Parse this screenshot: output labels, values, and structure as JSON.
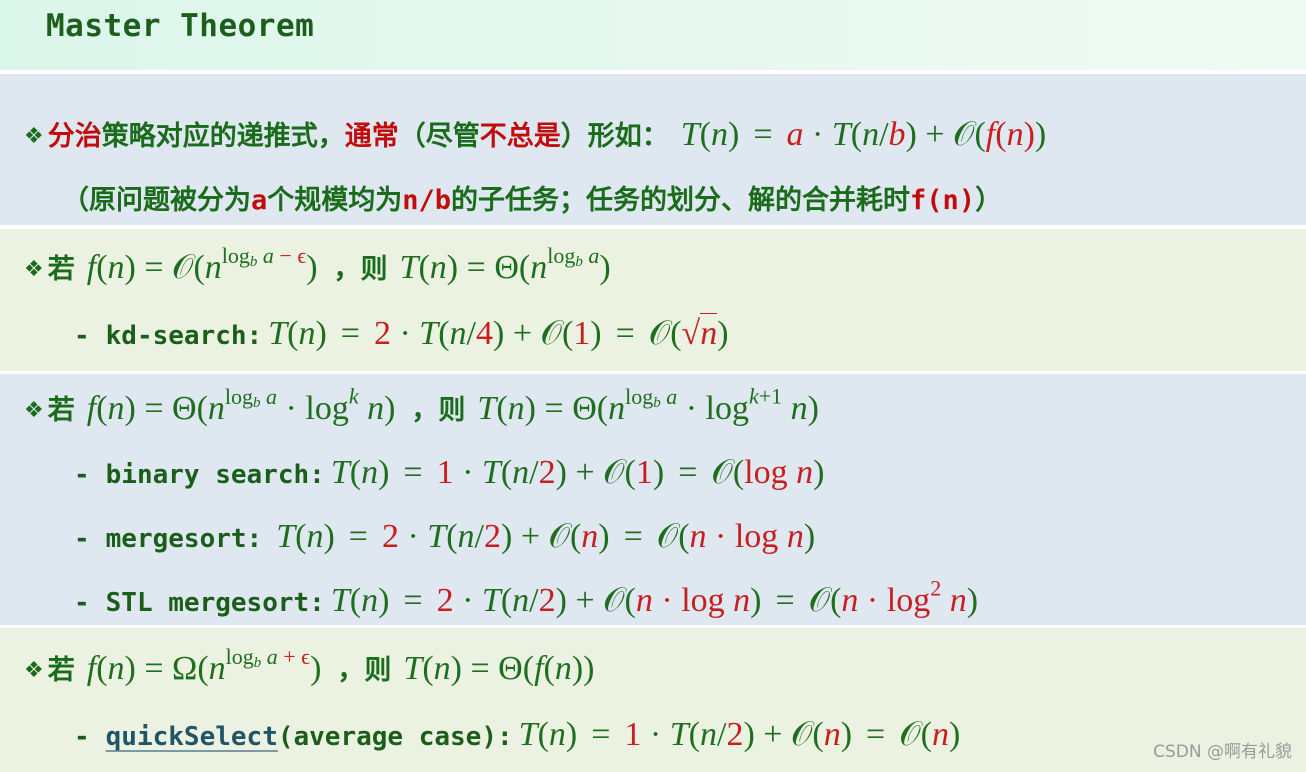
{
  "header": {
    "title": "Master Theorem"
  },
  "colors": {
    "text_green": "#1a6b1a",
    "accent_red": "#c20c0c",
    "math_green": "#1e6e1e",
    "link": "#1f5566",
    "bg_blue": "#dfe8f1",
    "bg_green": "#ebf2e1",
    "header_bg": "#dbf6ea"
  },
  "bullet_icon": "❖",
  "intro": {
    "segments": [
      {
        "text": "分治",
        "red": true
      },
      {
        "text": "策略对应的递推式，",
        "red": false
      },
      {
        "text": "通常",
        "red": true
      },
      {
        "text": "（尽管",
        "red": false
      },
      {
        "text": "不总是",
        "red": true
      },
      {
        "text": "）形如：",
        "red": false
      }
    ],
    "formula": [
      {
        "t": "T",
        "i": true
      },
      {
        "t": "("
      },
      {
        "t": "n",
        "i": true
      },
      {
        "t": ")"
      },
      {
        "sp": 1
      },
      {
        "t": "="
      },
      {
        "sp": 1
      },
      {
        "t": "a",
        "i": true,
        "r": true
      },
      {
        "t": " · "
      },
      {
        "t": "T",
        "i": true
      },
      {
        "t": "("
      },
      {
        "t": "n",
        "i": true
      },
      {
        "t": "/"
      },
      {
        "t": "b",
        "i": true,
        "r": true
      },
      {
        "t": ")"
      },
      {
        "t": " + "
      },
      {
        "t": "𝒪",
        "i": false
      },
      {
        "t": "("
      },
      {
        "t": "f",
        "i": true,
        "r": true
      },
      {
        "t": "(",
        "r": true
      },
      {
        "t": "n",
        "i": true,
        "r": true
      },
      {
        "t": ")",
        "r": true
      },
      {
        "t": ")"
      }
    ],
    "note_segments": [
      {
        "text": "（原问题被分为",
        "red": false
      },
      {
        "text": "a",
        "red": true,
        "mono": true
      },
      {
        "text": "个规模均为",
        "red": false
      },
      {
        "text": "n/b",
        "red": true,
        "mono": true
      },
      {
        "text": "的子任务；任务的划分、解的合并耗时",
        "red": false
      },
      {
        "text": "f(n)",
        "red": true,
        "mono": true
      },
      {
        "text": "）",
        "red": false
      }
    ]
  },
  "cases": [
    {
      "if_label": "若",
      "then_label": "，则",
      "condition": [
        {
          "t": "f",
          "i": true
        },
        {
          "t": "("
        },
        {
          "t": "n",
          "i": true
        },
        {
          "t": ")"
        },
        {
          "t": " = "
        },
        {
          "t": "𝒪"
        },
        {
          "t": "("
        },
        {
          "t": "n",
          "i": true
        },
        {
          "sup": [
            {
              "t": "log"
            },
            {
              "sub": "b",
              "i": true
            },
            {
              "t": " a",
              "i": true
            },
            {
              "t": " − ϵ",
              "r": true
            }
          ]
        },
        {
          "t": ")"
        }
      ],
      "result": [
        {
          "t": "T",
          "i": true
        },
        {
          "t": "("
        },
        {
          "t": "n",
          "i": true
        },
        {
          "t": ")"
        },
        {
          "t": " = "
        },
        {
          "t": "Θ"
        },
        {
          "t": "("
        },
        {
          "t": "n",
          "i": true
        },
        {
          "sup": [
            {
              "t": "log"
            },
            {
              "sub": "b",
              "i": true
            },
            {
              "t": " a",
              "i": true
            }
          ]
        },
        {
          "t": ")"
        }
      ],
      "examples": [
        {
          "name": "kd-search:",
          "link": false,
          "formula": [
            {
              "t": "T",
              "i": true
            },
            {
              "t": "("
            },
            {
              "t": "n",
              "i": true
            },
            {
              "t": ")"
            },
            {
              "sp": 1
            },
            {
              "t": "="
            },
            {
              "sp": 1
            },
            {
              "t": "2",
              "r": true
            },
            {
              "t": " · "
            },
            {
              "t": "T",
              "i": true
            },
            {
              "t": "("
            },
            {
              "t": "n",
              "i": true
            },
            {
              "t": "/"
            },
            {
              "t": "4",
              "r": true
            },
            {
              "t": ")"
            },
            {
              "t": " + "
            },
            {
              "t": "𝒪"
            },
            {
              "t": "("
            },
            {
              "t": "1",
              "r": true
            },
            {
              "t": ")"
            },
            {
              "sp": 1
            },
            {
              "t": "="
            },
            {
              "sp": 1
            },
            {
              "t": "𝒪"
            },
            {
              "t": "("
            },
            {
              "t": "√",
              "r": true
            },
            {
              "t": "n",
              "i": true,
              "r": true,
              "over": true
            },
            {
              "t": ")"
            }
          ]
        }
      ]
    },
    {
      "if_label": "若",
      "then_label": "，则",
      "condition": [
        {
          "t": "f",
          "i": true
        },
        {
          "t": "("
        },
        {
          "t": "n",
          "i": true
        },
        {
          "t": ")"
        },
        {
          "t": " = "
        },
        {
          "t": "Θ"
        },
        {
          "t": "("
        },
        {
          "t": "n",
          "i": true
        },
        {
          "sup": [
            {
              "t": "log"
            },
            {
              "sub": "b",
              "i": true
            },
            {
              "t": " a",
              "i": true
            }
          ]
        },
        {
          "t": " · log"
        },
        {
          "sup": [
            {
              "t": "k",
              "i": true
            }
          ]
        },
        {
          "t": " "
        },
        {
          "t": "n",
          "i": true
        },
        {
          "t": ")"
        }
      ],
      "result": [
        {
          "t": "T",
          "i": true
        },
        {
          "t": "("
        },
        {
          "t": "n",
          "i": true
        },
        {
          "t": ")"
        },
        {
          "t": " = "
        },
        {
          "t": "Θ"
        },
        {
          "t": "("
        },
        {
          "t": "n",
          "i": true
        },
        {
          "sup": [
            {
              "t": "log"
            },
            {
              "sub": "b",
              "i": true
            },
            {
              "t": " a",
              "i": true
            }
          ]
        },
        {
          "t": " · log"
        },
        {
          "sup": [
            {
              "t": "k",
              "i": true
            },
            {
              "t": "+1"
            }
          ]
        },
        {
          "t": " "
        },
        {
          "t": "n",
          "i": true
        },
        {
          "t": ")"
        }
      ],
      "examples": [
        {
          "name": "binary search:",
          "link": false,
          "formula": [
            {
              "t": "T",
              "i": true
            },
            {
              "t": "("
            },
            {
              "t": "n",
              "i": true
            },
            {
              "t": ")"
            },
            {
              "sp": 1
            },
            {
              "t": "="
            },
            {
              "sp": 1
            },
            {
              "t": "1",
              "r": true
            },
            {
              "t": " · "
            },
            {
              "t": "T",
              "i": true
            },
            {
              "t": "("
            },
            {
              "t": "n",
              "i": true
            },
            {
              "t": "/"
            },
            {
              "t": "2",
              "r": true
            },
            {
              "t": ")"
            },
            {
              "t": " + "
            },
            {
              "t": "𝒪"
            },
            {
              "t": "("
            },
            {
              "t": "1",
              "r": true
            },
            {
              "t": ")"
            },
            {
              "sp": 1
            },
            {
              "t": "="
            },
            {
              "sp": 1
            },
            {
              "t": "𝒪"
            },
            {
              "t": "("
            },
            {
              "t": "log ",
              "r": true
            },
            {
              "t": "n",
              "i": true,
              "r": true
            },
            {
              "t": ")"
            }
          ]
        },
        {
          "name": "mergesort:",
          "link": false,
          "formula": [
            {
              "t": "T",
              "i": true
            },
            {
              "t": "("
            },
            {
              "t": "n",
              "i": true
            },
            {
              "t": ")"
            },
            {
              "sp": 1
            },
            {
              "t": "="
            },
            {
              "sp": 1
            },
            {
              "t": "2",
              "r": true
            },
            {
              "t": " · "
            },
            {
              "t": "T",
              "i": true
            },
            {
              "t": "("
            },
            {
              "t": "n",
              "i": true
            },
            {
              "t": "/"
            },
            {
              "t": "2",
              "r": true
            },
            {
              "t": ")"
            },
            {
              "t": " + "
            },
            {
              "t": "𝒪"
            },
            {
              "t": "("
            },
            {
              "t": "n",
              "i": true,
              "r": true
            },
            {
              "t": ")"
            },
            {
              "sp": 1
            },
            {
              "t": "="
            },
            {
              "sp": 1
            },
            {
              "t": "𝒪"
            },
            {
              "t": "("
            },
            {
              "t": "n",
              "i": true,
              "r": true
            },
            {
              "t": " · ",
              "r": true
            },
            {
              "t": "log ",
              "r": true
            },
            {
              "t": "n",
              "i": true,
              "r": true
            },
            {
              "t": ")"
            }
          ]
        },
        {
          "name": "STL mergesort:",
          "link": false,
          "formula": [
            {
              "t": "T",
              "i": true
            },
            {
              "t": "("
            },
            {
              "t": "n",
              "i": true
            },
            {
              "t": ")"
            },
            {
              "sp": 1
            },
            {
              "t": "="
            },
            {
              "sp": 1
            },
            {
              "t": "2",
              "r": true
            },
            {
              "t": " · "
            },
            {
              "t": "T",
              "i": true
            },
            {
              "t": "("
            },
            {
              "t": "n",
              "i": true
            },
            {
              "t": "/"
            },
            {
              "t": "2",
              "r": true
            },
            {
              "t": ")"
            },
            {
              "t": " + "
            },
            {
              "t": "𝒪"
            },
            {
              "t": "("
            },
            {
              "t": "n",
              "i": true,
              "r": true
            },
            {
              "t": " · ",
              "r": true
            },
            {
              "t": "log ",
              "r": true
            },
            {
              "t": "n",
              "i": true,
              "r": true
            },
            {
              "t": ")"
            },
            {
              "sp": 1
            },
            {
              "t": "="
            },
            {
              "sp": 1
            },
            {
              "t": "𝒪"
            },
            {
              "t": "("
            },
            {
              "t": "n",
              "i": true,
              "r": true
            },
            {
              "t": " · ",
              "r": true
            },
            {
              "t": "log",
              "r": true
            },
            {
              "sup": [
                {
                  "t": "2",
                  "r": true
                }
              ]
            },
            {
              "t": " "
            },
            {
              "t": "n",
              "i": true,
              "r": true
            },
            {
              "t": ")"
            }
          ]
        }
      ]
    },
    {
      "if_label": "若",
      "then_label": "，则",
      "condition": [
        {
          "t": "f",
          "i": true
        },
        {
          "t": "("
        },
        {
          "t": "n",
          "i": true
        },
        {
          "t": ")"
        },
        {
          "t": " = "
        },
        {
          "t": "Ω"
        },
        {
          "t": "("
        },
        {
          "t": "n",
          "i": true
        },
        {
          "sup": [
            {
              "t": "log"
            },
            {
              "sub": "b",
              "i": true
            },
            {
              "t": " a",
              "i": true
            },
            {
              "t": " + ϵ",
              "r": true
            }
          ]
        },
        {
          "t": ")"
        }
      ],
      "result": [
        {
          "t": "T",
          "i": true
        },
        {
          "t": "("
        },
        {
          "t": "n",
          "i": true
        },
        {
          "t": ")"
        },
        {
          "t": " = "
        },
        {
          "t": "Θ"
        },
        {
          "t": "("
        },
        {
          "t": "f",
          "i": true
        },
        {
          "t": "("
        },
        {
          "t": "n",
          "i": true
        },
        {
          "t": ")"
        },
        {
          "t": ")"
        }
      ],
      "examples": [
        {
          "name": "quickSelect",
          "link": true,
          "suffix": " (average case):",
          "formula": [
            {
              "t": "T",
              "i": true
            },
            {
              "t": "("
            },
            {
              "t": "n",
              "i": true
            },
            {
              "t": ")"
            },
            {
              "sp": 1
            },
            {
              "t": "="
            },
            {
              "sp": 1
            },
            {
              "t": "1",
              "r": true
            },
            {
              "t": " · "
            },
            {
              "t": "T",
              "i": true
            },
            {
              "t": "("
            },
            {
              "t": "n",
              "i": true
            },
            {
              "t": "/"
            },
            {
              "t": "2",
              "r": true
            },
            {
              "t": ")"
            },
            {
              "t": " + "
            },
            {
              "t": "𝒪"
            },
            {
              "t": "("
            },
            {
              "t": "n",
              "i": true,
              "r": true
            },
            {
              "t": ")"
            },
            {
              "sp": 1
            },
            {
              "t": "="
            },
            {
              "sp": 1
            },
            {
              "t": "𝒪"
            },
            {
              "t": "("
            },
            {
              "t": "n",
              "i": true,
              "r": true
            },
            {
              "t": ")"
            }
          ]
        }
      ]
    }
  ],
  "example_dash": "-",
  "watermark": "CSDN @啊有礼貌"
}
